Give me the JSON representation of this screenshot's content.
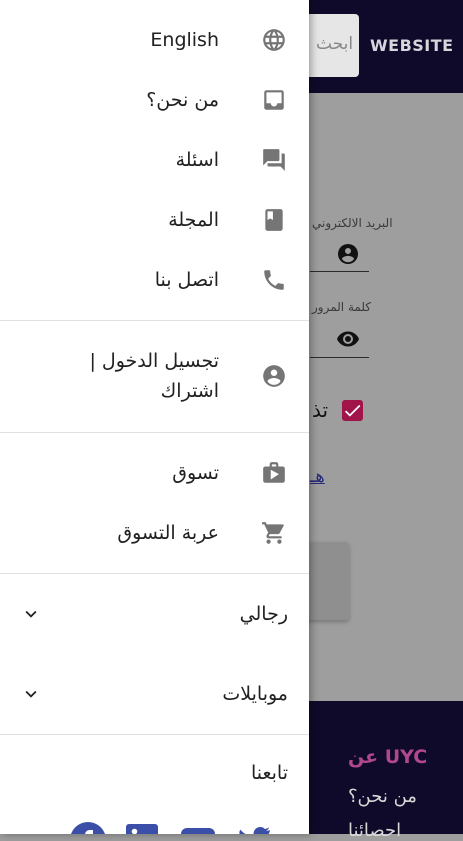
{
  "background": {
    "logo_text": "WEBSITE",
    "search_placeholder": "ابحث",
    "email_label": "البريد الالكتروني",
    "password_label": "كلمة المرور",
    "remember_label": "تذكرني",
    "forgot_link": "هل نسيت",
    "footer": {
      "title": "عن UYC",
      "links": [
        "من نحن؟",
        "احصائنا"
      ]
    }
  },
  "drawer": {
    "items": [
      {
        "label": "English",
        "icon": "globe-icon"
      },
      {
        "label": "من نحن؟",
        "icon": "inbox-icon"
      },
      {
        "label": "اسئلة",
        "icon": "forum-icon"
      },
      {
        "label": "المجلة",
        "icon": "book-icon"
      },
      {
        "label": "اتصل بنا",
        "icon": "phone-icon"
      }
    ],
    "account": {
      "line1": "تجسيل الدخول |",
      "line2": "اشتراك",
      "icon": "account-circle-icon"
    },
    "shop": [
      {
        "label": "تسوق",
        "icon": "shopping-bag-icon"
      },
      {
        "label": "عربة التسوق",
        "icon": "cart-icon"
      }
    ],
    "categories": [
      {
        "label": "رجالي"
      },
      {
        "label": "موبايلات"
      }
    ],
    "follow_label": "تابعنا",
    "social": [
      "facebook-icon",
      "linkedin-icon",
      "youtube-icon",
      "twitter-icon"
    ],
    "colors": {
      "icon_gray": "#757575",
      "accent": "#a0144a",
      "header_navy": "#0f0a2a",
      "footer_title": "#b1478e"
    }
  }
}
